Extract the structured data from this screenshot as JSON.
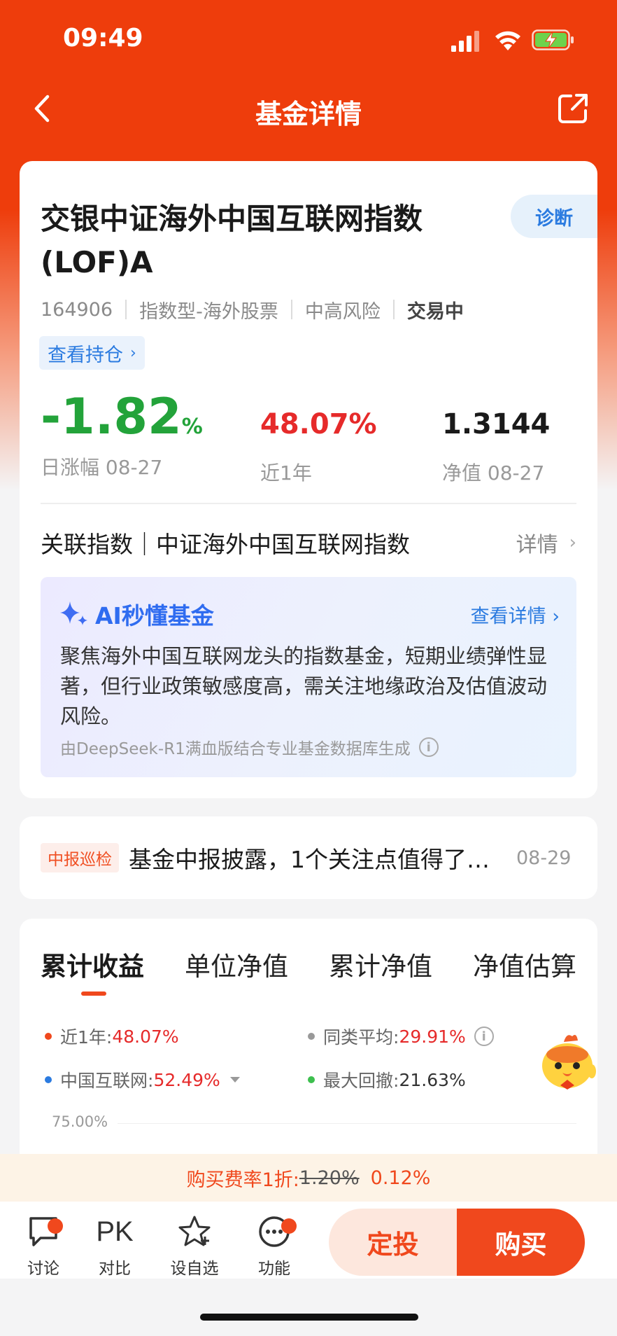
{
  "status_bar": {
    "time": "09:49"
  },
  "nav": {
    "title": "基金详情"
  },
  "fund": {
    "name": "交银中证海外中国互联网指数(LOF)A",
    "diagnose_label": "诊断",
    "code": "164906",
    "type": "指数型-海外股票",
    "risk": "中高风险",
    "trade_status": "交易中",
    "holdings_link": "查看持仓",
    "daily_change": "-1.82",
    "daily_change_unit": "%",
    "daily_change_label": "日涨幅 08-27",
    "one_year": "48.07%",
    "one_year_label": "近1年",
    "nav_value": "1.3144",
    "nav_label": "净值 08-27"
  },
  "index": {
    "text": "关联指数｜中证海外中国互联网指数",
    "detail": "详情"
  },
  "ai": {
    "title": "AI秒懂基金",
    "more": "查看详情",
    "summary": "聚焦海外中国互联网龙头的指数基金，短期业绩弹性显著，但行业政策敏感度高，需关注地缘政治及估值波动风险。",
    "source": "由DeepSeek-R1满血版结合专业基金数据库生成"
  },
  "news": {
    "tag": "中报巡检",
    "text": "基金中报披露，1个关注点值得了…",
    "date": "08-29"
  },
  "chart_tabs": [
    "累计收益",
    "单位净值",
    "累计净值",
    "净值估算"
  ],
  "legend": [
    {
      "label": "近1年:",
      "value": "48.07%",
      "color": "#f0481d"
    },
    {
      "label": "同类平均:",
      "value": "29.91%",
      "color": "#999999"
    },
    {
      "label": "中国互联网:",
      "value": "52.49%",
      "color": "#2b7be0"
    },
    {
      "label": "最大回撤:",
      "value": "21.63%",
      "color": "#3dbf4e"
    }
  ],
  "chart_data": {
    "type": "line",
    "ytick_top": "75.00%"
  },
  "fee": {
    "prefix": "购买费率1折:",
    "old": "1.20%",
    "new": "0.12%"
  },
  "bottom_nav": {
    "discuss": "讨论",
    "compare_icon": "PK",
    "compare": "对比",
    "watchlist": "设自选",
    "functions": "功能",
    "sip_button": "定投",
    "buy_button": "购买"
  },
  "colors": {
    "brand": "#ee3d0c",
    "up": "#e62a2a",
    "down": "#23a33a",
    "link": "#2b7be0"
  }
}
